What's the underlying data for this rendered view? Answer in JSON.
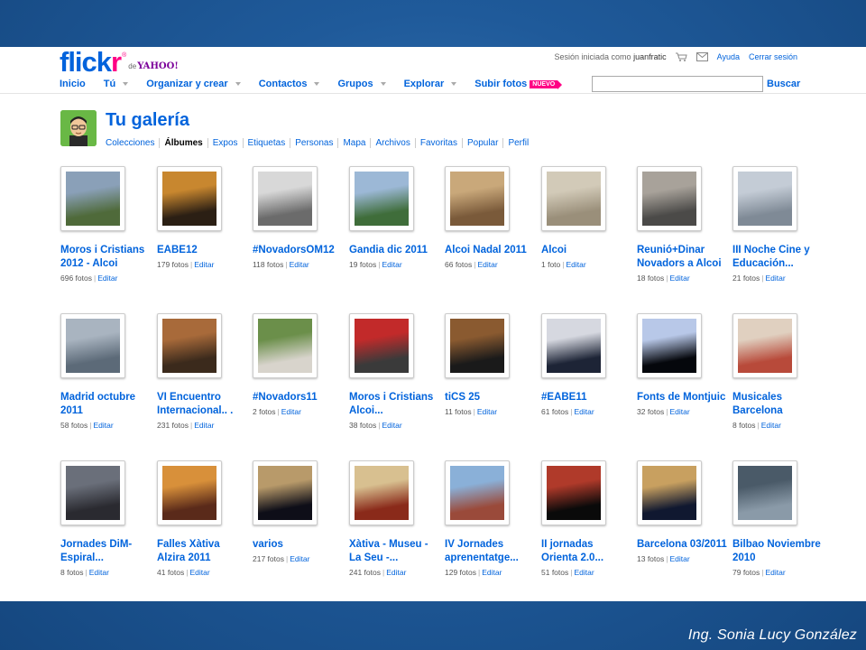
{
  "header": {
    "logo_main": "flick",
    "logo_r": "r",
    "logo_reg": "®",
    "logo_de": "de",
    "logo_yahoo": "YAHOO!",
    "session_text": "Sesión iniciada como",
    "username": "juanfratic",
    "help": "Ayuda",
    "logout": "Cerrar sesión",
    "nav": [
      {
        "label": "Inicio",
        "chevron": false
      },
      {
        "label": "Tú",
        "chevron": true
      },
      {
        "label": "Organizar y crear",
        "chevron": true
      },
      {
        "label": "Contactos",
        "chevron": true
      },
      {
        "label": "Grupos",
        "chevron": true
      },
      {
        "label": "Explorar",
        "chevron": true
      },
      {
        "label": "Subir fotos",
        "chevron": false,
        "badge": "NUEVO"
      }
    ],
    "search_button": "Buscar",
    "search_value": ""
  },
  "gallery": {
    "title": "Tu galería",
    "tabs": [
      "Colecciones",
      "Álbumes",
      "Expos",
      "Etiquetas",
      "Personas",
      "Mapa",
      "Archivos",
      "Favoritas",
      "Popular",
      "Perfil"
    ],
    "active_tab": "Álbumes"
  },
  "edit_label": "Editar",
  "albums": [
    {
      "title": "Moros i Cristians 2012 - Alcoi",
      "count": "696 fotos"
    },
    {
      "title": "EABE12",
      "count": "179 fotos"
    },
    {
      "title": "#NovadorsOM12",
      "count": "118 fotos"
    },
    {
      "title": "Gandia dic 2011",
      "count": "19 fotos"
    },
    {
      "title": "Alcoi Nadal 2011",
      "count": "66 fotos"
    },
    {
      "title": "Alcoi",
      "count": "1 foto"
    },
    {
      "title": "Reunió+Dinar Novadors a Alcoi",
      "count": "18 fotos"
    },
    {
      "title": "III Noche Cine y Educación...",
      "count": "21 fotos"
    },
    {
      "title": "Madrid octubre 2011",
      "count": "58 fotos"
    },
    {
      "title": "VI Encuentro Internacional.. .",
      "count": "231 fotos"
    },
    {
      "title": "#Novadors11",
      "count": "2 fotos"
    },
    {
      "title": "Moros i Cristians Alcoi...",
      "count": "38 fotos"
    },
    {
      "title": "tiCS 25",
      "count": "11 fotos"
    },
    {
      "title": "#EABE11",
      "count": "61 fotos"
    },
    {
      "title": "Fonts de Montjuic",
      "count": "32 fotos"
    },
    {
      "title": "Musicales Barcelona",
      "count": "8 fotos"
    },
    {
      "title": "Jornades DiM-Espiral...",
      "count": "8 fotos"
    },
    {
      "title": "Falles Xàtiva Alzira 2011",
      "count": "41 fotos"
    },
    {
      "title": "varios",
      "count": "217 fotos"
    },
    {
      "title": "Xàtiva - Museu - La Seu -...",
      "count": "241 fotos"
    },
    {
      "title": "IV Jornades aprenentatge...",
      "count": "129 fotos"
    },
    {
      "title": "II jornadas Orienta 2.0...",
      "count": "51 fotos"
    },
    {
      "title": "Barcelona 03/2011",
      "count": "13 fotos"
    },
    {
      "title": "Bilbao Noviembre 2010",
      "count": "79 fotos"
    }
  ],
  "thumb_colors": [
    [
      "#4f6a3a",
      "#8aa0b8"
    ],
    [
      "#2b1f14",
      "#c8872f"
    ],
    [
      "#6b6b6b",
      "#d8d8d8"
    ],
    [
      "#3f6d3a",
      "#9cb8d6"
    ],
    [
      "#7a5a3a",
      "#c9a87a"
    ],
    [
      "#9a8f7a",
      "#d2cab8"
    ],
    [
      "#4b4a48",
      "#a8a29a"
    ],
    [
      "#7f8a96",
      "#c4ccd6"
    ],
    [
      "#5c6a78",
      "#a9b4c0"
    ],
    [
      "#3b2a1c",
      "#a86a3a"
    ],
    [
      "#d8d4cc",
      "#6b8f4a"
    ],
    [
      "#3a3a3a",
      "#c22a2a"
    ],
    [
      "#1a1a1a",
      "#8a5a30"
    ],
    [
      "#1d2436",
      "#d6d8e0"
    ],
    [
      "#05070c",
      "#b8c8e8"
    ],
    [
      "#b84a3a",
      "#e0d0c0"
    ],
    [
      "#2a2a30",
      "#6a6f7a"
    ],
    [
      "#5a2a1a",
      "#d8903a"
    ],
    [
      "#0e0e18",
      "#b89a6a"
    ],
    [
      "#8a2a1a",
      "#d8c090"
    ],
    [
      "#9a4a3a",
      "#8ab0d8"
    ],
    [
      "#0a0a0a",
      "#b03a2a"
    ],
    [
      "#101830",
      "#c8a060"
    ],
    [
      "#8a9aa8",
      "#4a5a68"
    ]
  ],
  "credit": "Ing. Sonia Lucy González"
}
